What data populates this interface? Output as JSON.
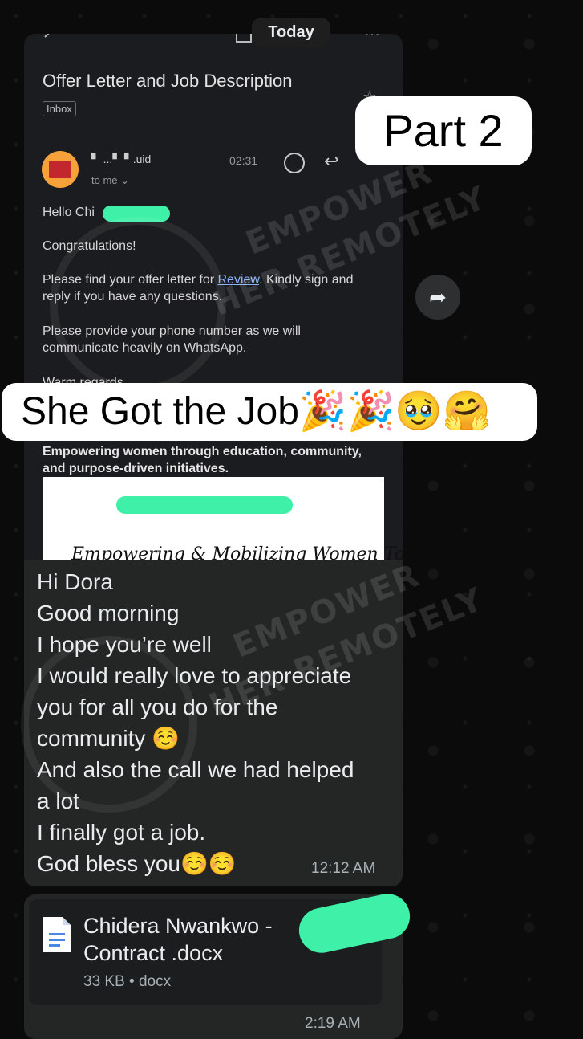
{
  "date_pill": "Today",
  "email": {
    "title": "Offer Letter and Job Description",
    "folder_tag": "Inbox",
    "sender_visible": "▘ ...▘ ▘.uid",
    "time": "02:31",
    "to_line": "to me ⌄",
    "greeting": "Hello Chi",
    "congrats": "Congratulations!",
    "para1_before": "Please find your offer letter for ",
    "para1_link": "Review",
    "para1_after": ". Kindly sign and reply if you have any questions.",
    "para2": "Please provide your phone number as we will communicate heavily on WhatsApp.",
    "signoff": "Warm regards,",
    "banner": "Empowering women through education, community, and purpose-driven initiatives.",
    "letterhead_script": "Empowering & Mobilizing Women To Be"
  },
  "watermark": {
    "line1": "EMPOWER",
    "line2": "HER REMOTELY"
  },
  "overlays": {
    "part_label": "Part 2",
    "headline": "She Got the Job🎉🎉🥹🤗"
  },
  "message": {
    "lines": [
      "Hi Dora",
      "Good morning",
      "I hope you’re well",
      "I would really love to appreciate",
      "you for all you do for the",
      "community ☺️",
      "And also the call we had helped",
      "a lot",
      "I finally got a job.",
      "God bless you☺️☺️"
    ],
    "time": "12:12 AM"
  },
  "document": {
    "name_line1": "Chidera Nwankwo -",
    "name_line2": "Contract .docx",
    "meta": "33 KB • docx",
    "time": "2:19 AM"
  },
  "colors": {
    "redaction": "#3ff1a8",
    "link": "#8ab4f8",
    "bubble": "#242626"
  }
}
